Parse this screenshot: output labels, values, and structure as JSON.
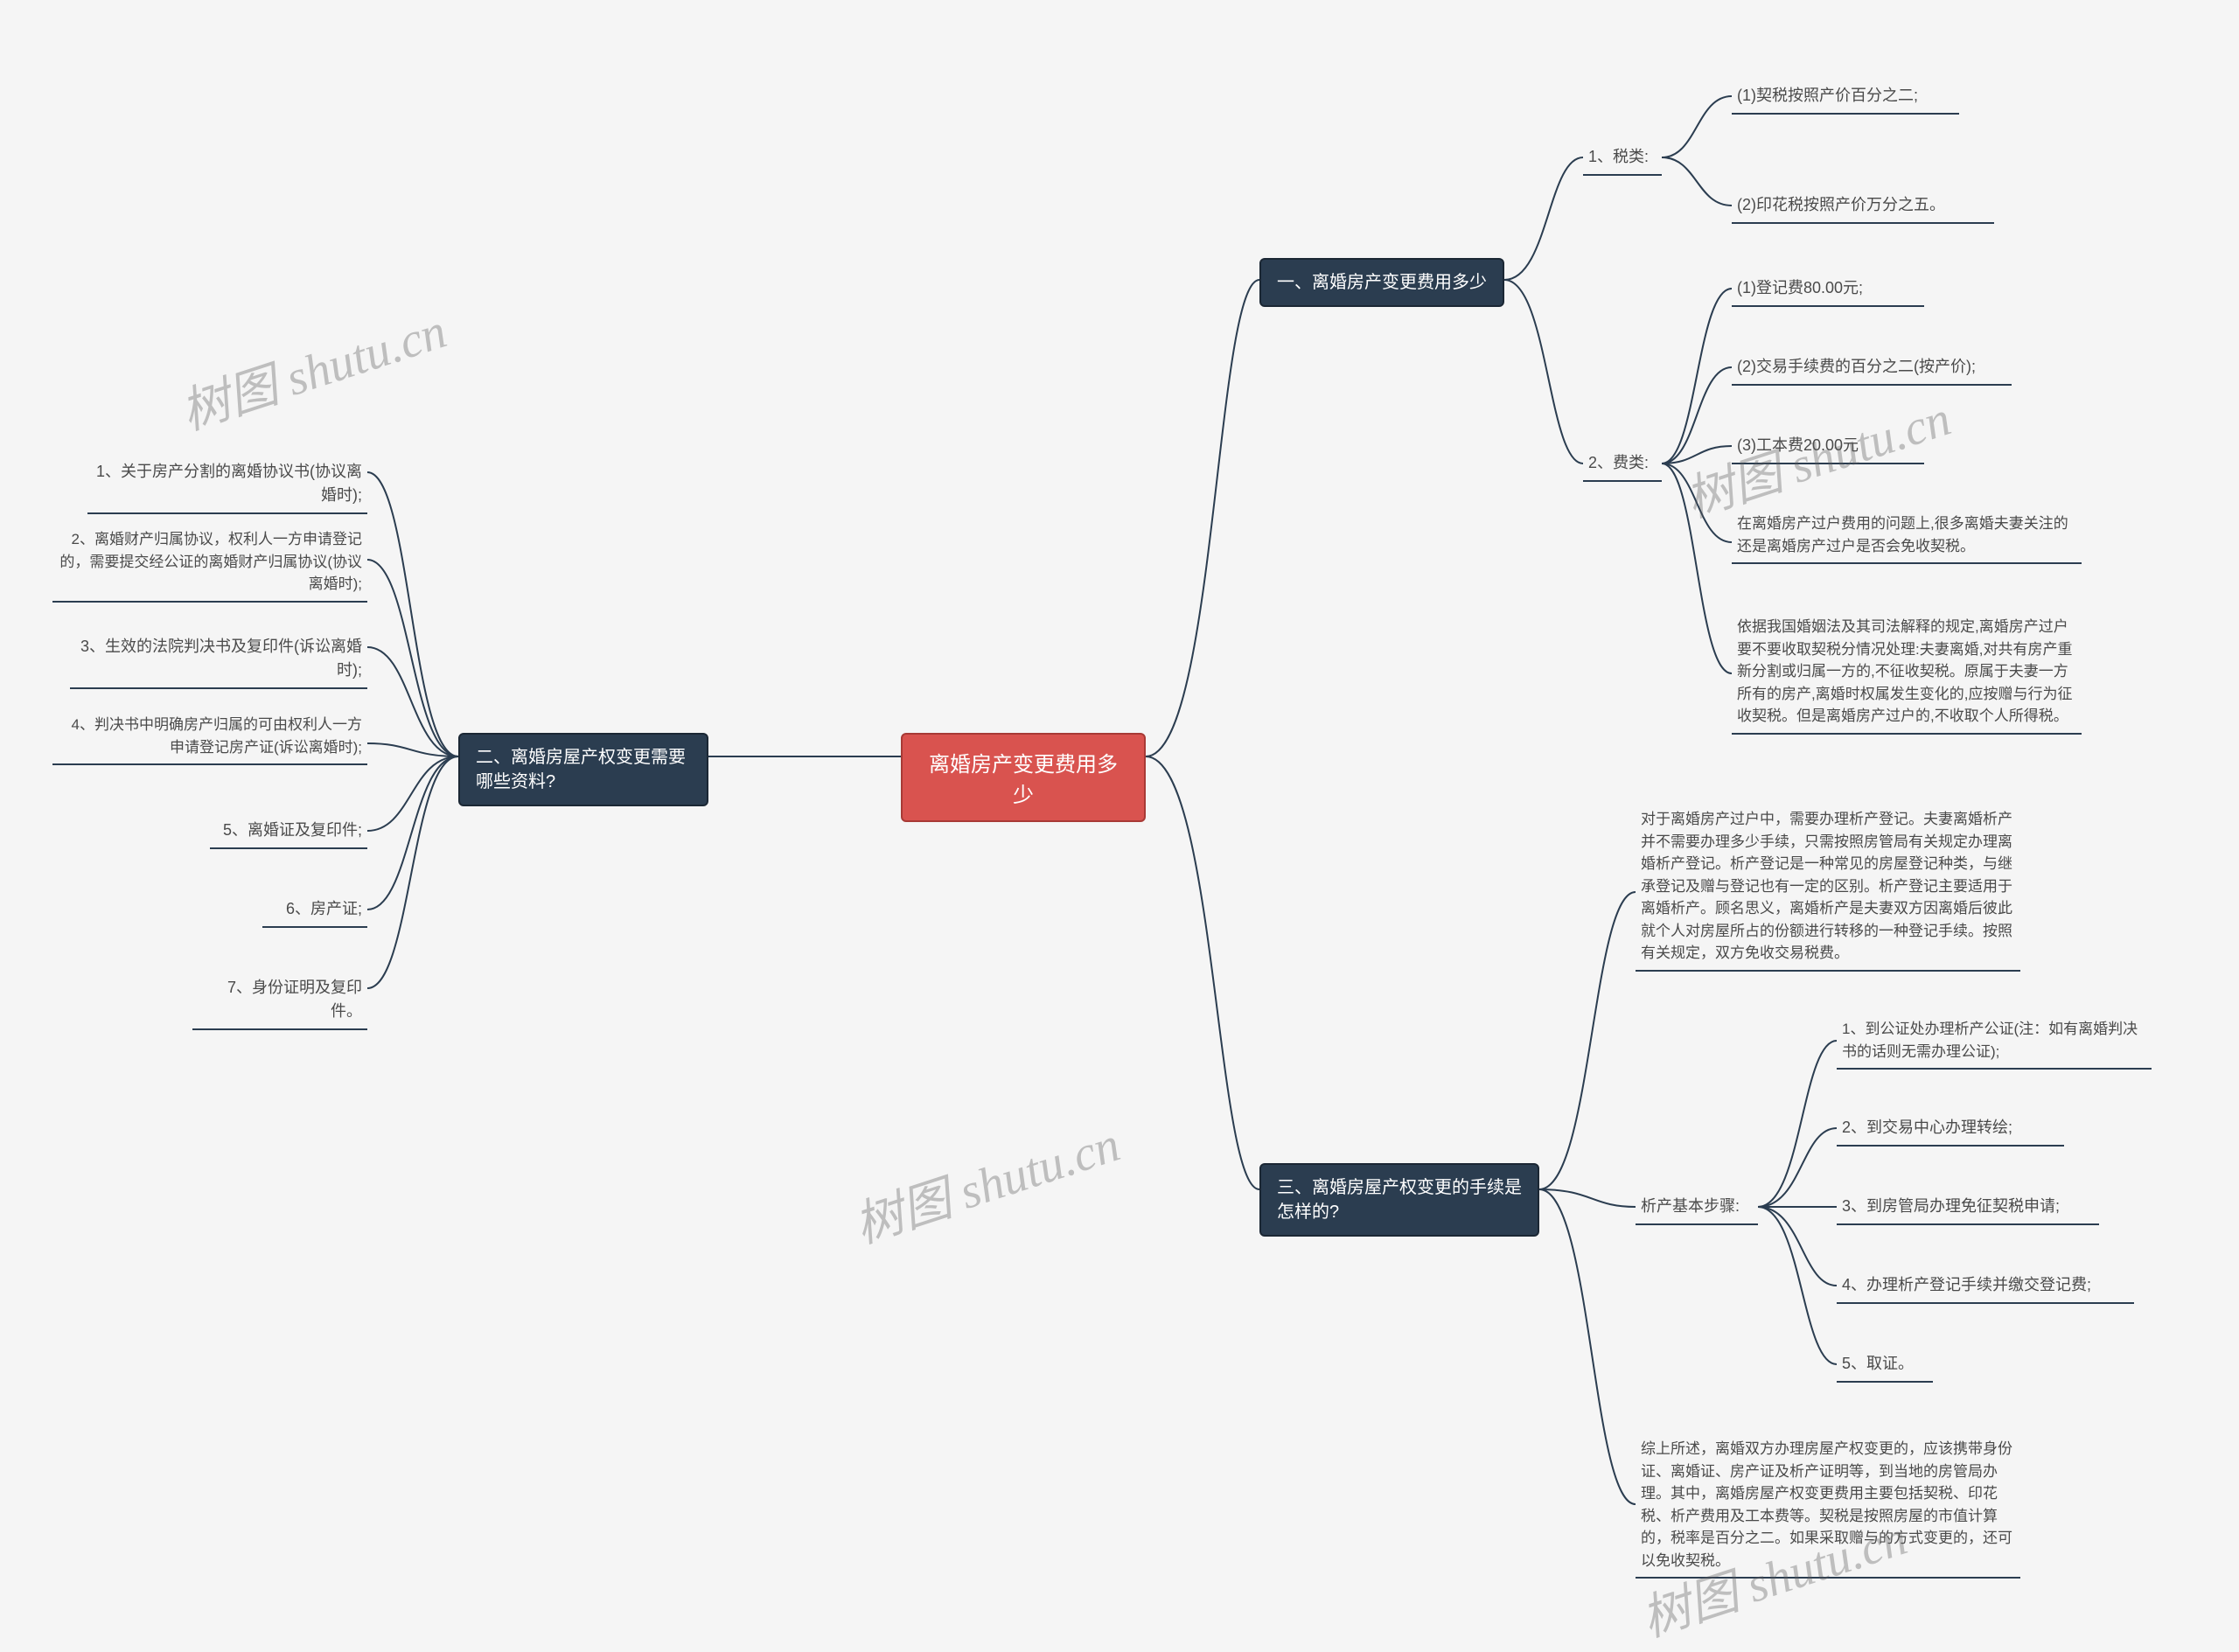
{
  "root": {
    "title": "离婚房产变更费用多少"
  },
  "section1": {
    "title": "一、离婚房产变更费用多少",
    "taxes_label": "1、税类:",
    "taxes": {
      "t1": "(1)契税按照产价百分之二;",
      "t2": "(2)印花税按照产价万分之五。"
    },
    "fees_label": "2、费类:",
    "fees": {
      "f1": "(1)登记费80.00元;",
      "f2": "(2)交易手续费的百分之二(按产价);",
      "f3": "(3)工本费20.00元",
      "f4": "在离婚房产过户费用的问题上,很多离婚夫妻关注的还是离婚房产过户是否会免收契税。",
      "f5": "依据我国婚姻法及其司法解释的规定,离婚房产过户要不要收取契税分情况处理:夫妻离婚,对共有房产重新分割或归属一方的,不征收契税。原属于夫妻一方所有的房产,离婚时权属发生变化的,应按赠与行为征收契税。但是离婚房产过户的,不收取个人所得税。"
    }
  },
  "section2": {
    "title": "二、离婚房屋产权变更需要哪些资料?",
    "items": {
      "m1": "1、关于房产分割的离婚协议书(协议离婚时);",
      "m2": "2、离婚财产归属协议，权利人一方申请登记的，需要提交经公证的离婚财产归属协议(协议离婚时);",
      "m3": "3、生效的法院判决书及复印件(诉讼离婚时);",
      "m4": "4、判决书中明确房产归属的可由权利人一方申请登记房产证(诉讼离婚时);",
      "m5": "5、离婚证及复印件;",
      "m6": "6、房产证;",
      "m7": "7、身份证明及复印件。"
    }
  },
  "section3": {
    "title": "三、离婚房屋产权变更的手续是怎样的?",
    "intro": "对于离婚房产过户中，需要办理析产登记。夫妻离婚析产并不需要办理多少手续，只需按照房管局有关规定办理离婚析产登记。析产登记是一种常见的房屋登记种类，与继承登记及赠与登记也有一定的区别。析产登记主要适用于离婚析产。顾名思义，离婚析产是夫妻双方因离婚后彼此就个人对房屋所占的份额进行转移的一种登记手续。按照有关规定，双方免收交易税费。",
    "steps_label": "析产基本步骤:",
    "steps": {
      "s1": "1、到公证处办理析产公证(注：如有离婚判决书的话则无需办理公证);",
      "s2": "2、到交易中心办理转绘;",
      "s3": "3、到房管局办理免征契税申请;",
      "s4": "4、办理析产登记手续并缴交登记费;",
      "s5": "5、取证。"
    },
    "summary": "综上所述，离婚双方办理房屋产权变更的，应该携带身份证、离婚证、房产证及析产证明等，到当地的房管局办理。其中，离婚房屋产权变更费用主要包括契税、印花税、析产费用及工本费等。契税是按照房屋的市值计算的，税率是百分之二。如果采取赠与的方式变更的，还可以免收契税。"
  },
  "watermark": "树图 shutu.cn"
}
